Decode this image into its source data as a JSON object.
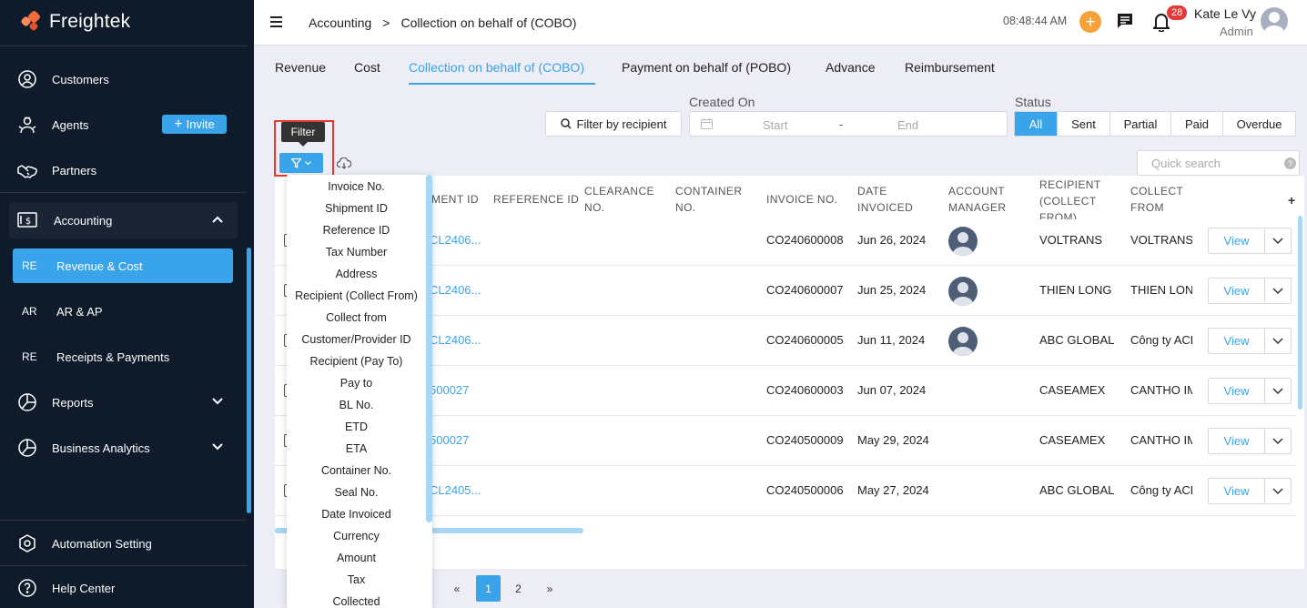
{
  "app": {
    "name": "Freightek"
  },
  "sidebar": {
    "items": [
      {
        "label": "Customers",
        "icon": "customers-icon"
      },
      {
        "label": "Agents",
        "icon": "agents-icon",
        "action_label": "Invite"
      },
      {
        "label": "Partners",
        "icon": "handshake-icon"
      }
    ],
    "accounting": {
      "label": "Accounting",
      "expanded": true,
      "subitems": [
        {
          "abbr": "RE",
          "label": "Revenue & Cost",
          "active": true
        },
        {
          "abbr": "AR",
          "label": "AR & AP",
          "active": false
        },
        {
          "abbr": "RE",
          "label": "Receipts & Payments",
          "active": false
        }
      ]
    },
    "reports": {
      "label": "Reports"
    },
    "business_analytics": {
      "label": "Business Analytics"
    },
    "bottom": [
      {
        "label": "Automation Setting",
        "icon": "gear-icon"
      },
      {
        "label": "Help Center",
        "icon": "help-icon"
      }
    ]
  },
  "header": {
    "breadcrumb": [
      "Accounting",
      ">",
      "Collection on behalf of (COBO)"
    ],
    "time": "08:48:44 AM",
    "notification_count": "28",
    "user_name": "Kate Le Vy",
    "user_role": "Admin"
  },
  "tabs": [
    {
      "label": "Revenue",
      "active": false
    },
    {
      "label": "Cost",
      "active": false
    },
    {
      "label": "Collection on behalf of (COBO)",
      "active": true
    },
    {
      "label": "Payment on behalf of (POBO)",
      "active": false
    },
    {
      "label": "Advance",
      "active": false
    },
    {
      "label": "Reimbursement",
      "active": false
    }
  ],
  "filters": {
    "recipient_button": "Filter by recipient",
    "created_on_label": "Created On",
    "start_placeholder": "Start",
    "date_separator": "-",
    "end_placeholder": "End",
    "status_label": "Status",
    "status_options": [
      "All",
      "Sent",
      "Partial",
      "Paid",
      "Overdue"
    ],
    "status_selected": "All",
    "filter_tooltip": "Filter",
    "quick_search_placeholder": "Quick search",
    "quick_search_help": "?"
  },
  "table": {
    "columns": [
      "MENT ID",
      "REFERENCE ID",
      "CLEARANCE NO.",
      "CONTAINER NO.",
      "INVOICE NO.",
      "DATE INVOICED",
      "ACCOUNT MANAGER",
      "RECIPIENT (COLLECT FROM)",
      "COLLECT FROM"
    ],
    "add_column": "+",
    "rows": [
      {
        "shipment_id": "CL2406...",
        "invoice_no": "CO240600008",
        "date_invoiced": "Jun 26, 2024",
        "has_manager_avatar": true,
        "recipient": "VOLTRANS",
        "collect_from": "VOLTRANS",
        "action": "View"
      },
      {
        "shipment_id": "CL2406...",
        "invoice_no": "CO240600007",
        "date_invoiced": "Jun 25, 2024",
        "has_manager_avatar": true,
        "recipient": "THIEN LONG",
        "collect_from": "THIEN LONG",
        "action": "View"
      },
      {
        "shipment_id": "CL2406...",
        "invoice_no": "CO240600005",
        "date_invoiced": "Jun 11, 2024",
        "has_manager_avatar": true,
        "recipient": "ABC GLOBAL",
        "collect_from": "Công ty ACB",
        "action": "View"
      },
      {
        "shipment_id": "500027",
        "invoice_no": "CO240600003",
        "date_invoiced": "Jun 07, 2024",
        "has_manager_avatar": false,
        "recipient": "CASEAMEX",
        "collect_from": "CANTHO IMP",
        "action": "View"
      },
      {
        "shipment_id": "500027",
        "invoice_no": "CO240500009",
        "date_invoiced": "May 29, 2024",
        "has_manager_avatar": false,
        "recipient": "CASEAMEX",
        "collect_from": "CANTHO IMP",
        "action": "View"
      },
      {
        "shipment_id": "CL2405...",
        "invoice_no": "CO240500006",
        "date_invoiced": "May 27, 2024",
        "has_manager_avatar": false,
        "recipient": "ABC GLOBAL",
        "collect_from": "Công ty ACB",
        "action": "View"
      }
    ]
  },
  "pagination": {
    "prev": "«",
    "pages": [
      "1",
      "2"
    ],
    "current": "1",
    "next": "»"
  },
  "filter_dropdown": {
    "items": [
      "Invoice No.",
      "Shipment ID",
      "Reference ID",
      "Tax Number",
      "Address",
      "Recipient (Collect From)",
      "Collect from",
      "Customer/Provider ID",
      "Recipient (Pay To)",
      "Pay to",
      "BL No.",
      "ETD",
      "ETA",
      "Container No.",
      "Seal No.",
      "Date Invoiced",
      "Currency",
      "Amount",
      "Tax",
      "Collected"
    ]
  },
  "colors": {
    "accent": "#3aa4ea",
    "sidebar_bg": "#0f1a2b",
    "highlight": "#e53935",
    "orange": "#f6a13a"
  }
}
